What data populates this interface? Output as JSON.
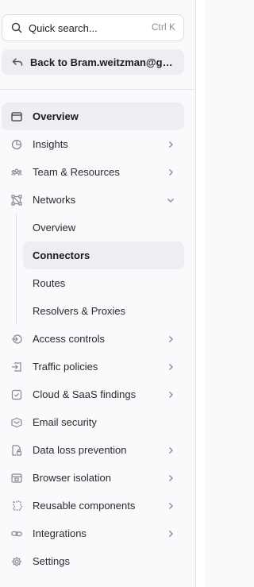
{
  "search": {
    "label": "Quick search...",
    "shortcut": "Ctrl K"
  },
  "back": {
    "label": "Back to Bram.weitzman@gm..."
  },
  "nav": {
    "overview": "Overview",
    "insights": "Insights",
    "team": "Team & Resources",
    "networks": "Networks",
    "networks_sub": {
      "overview": "Overview",
      "connectors": "Connectors",
      "routes": "Routes",
      "resolvers": "Resolvers & Proxies"
    },
    "access": "Access controls",
    "traffic": "Traffic policies",
    "cloud": "Cloud & SaaS findings",
    "email": "Email security",
    "dlp": "Data loss prevention",
    "browser": "Browser isolation",
    "reusable": "Reusable components",
    "integrations": "Integrations",
    "settings": "Settings"
  }
}
